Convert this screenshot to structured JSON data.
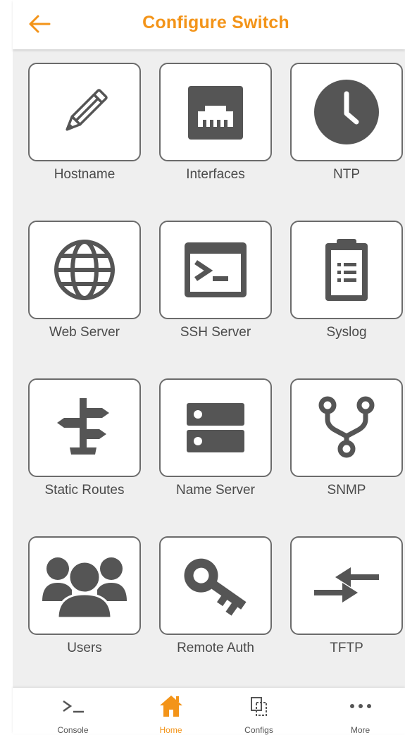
{
  "header": {
    "title": "Configure Switch",
    "back_icon": "arrow-left-icon"
  },
  "colors": {
    "accent": "#f39419",
    "icon": "#555555",
    "tile_border": "#6b6b6b",
    "background": "#efefef"
  },
  "tiles": [
    {
      "label": "Hostname",
      "icon": "pencil-icon"
    },
    {
      "label": "Interfaces",
      "icon": "ethernet-port-icon"
    },
    {
      "label": "NTP",
      "icon": "clock-icon"
    },
    {
      "label": "Web Server",
      "icon": "globe-icon"
    },
    {
      "label": "SSH Server",
      "icon": "terminal-icon"
    },
    {
      "label": "Syslog",
      "icon": "clipboard-icon"
    },
    {
      "label": "Static Routes",
      "icon": "signpost-icon"
    },
    {
      "label": "Name Server",
      "icon": "server-icon"
    },
    {
      "label": "SNMP",
      "icon": "fork-icon"
    },
    {
      "label": "Users",
      "icon": "users-icon"
    },
    {
      "label": "Remote Auth",
      "icon": "key-icon"
    },
    {
      "label": "TFTP",
      "icon": "transfer-arrows-icon"
    }
  ],
  "tabbar": {
    "items": [
      {
        "label": "Console",
        "icon": "console-icon",
        "active": false
      },
      {
        "label": "Home",
        "icon": "home-icon",
        "active": true
      },
      {
        "label": "Configs",
        "icon": "configs-icon",
        "active": false
      },
      {
        "label": "More",
        "icon": "more-icon",
        "active": false
      }
    ]
  }
}
